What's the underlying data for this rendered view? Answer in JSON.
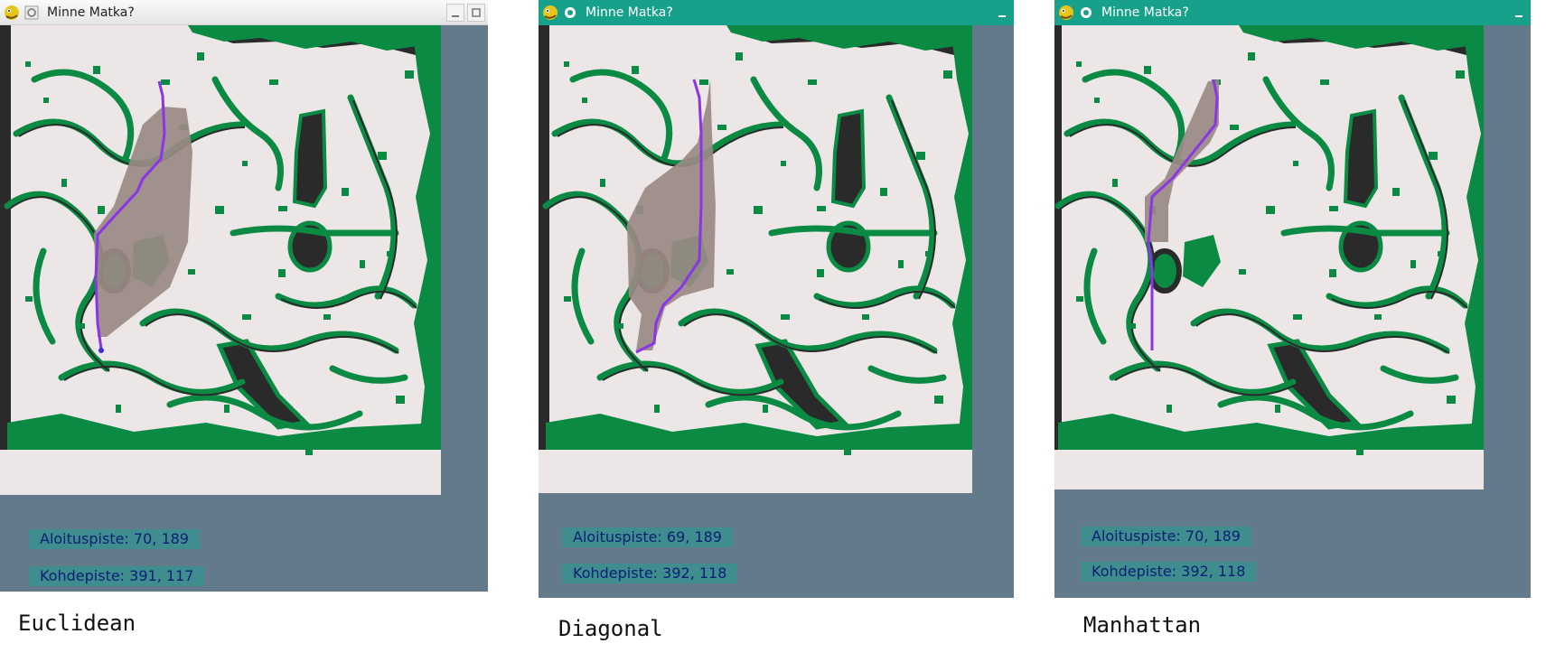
{
  "windows": [
    {
      "title": "Minne Matka?",
      "titlebar_style": "light",
      "start_label": "Aloituspiste: 70, 189",
      "goal_label": "Kohdepiste: 391, 117",
      "caption": "Euclidean"
    },
    {
      "title": "Minne Matka?",
      "titlebar_style": "teal",
      "start_label": "Aloituspiste: 69, 189",
      "goal_label": "Kohdepiste: 392, 118",
      "caption": "Diagonal"
    },
    {
      "title": "Minne Matka?",
      "titlebar_style": "teal",
      "start_label": "Aloituspiste: 70, 189",
      "goal_label": "Kohdepiste: 392, 118",
      "caption": "Manhattan"
    }
  ],
  "colors": {
    "terrain_bg": "#ece6e6",
    "vegetation": "#0b8a43",
    "rock": "#2a2a2a",
    "explored": "#9a8a85",
    "path": "#8a35e6",
    "panel": "#627a89",
    "label_bg": "#3f8d8f",
    "label_text": "#0c1f73",
    "teal_titlebar": "#17a08a"
  },
  "icons": [
    "pygame-snake-icon",
    "window-menu-icon",
    "minimize-icon",
    "maximize-icon"
  ]
}
